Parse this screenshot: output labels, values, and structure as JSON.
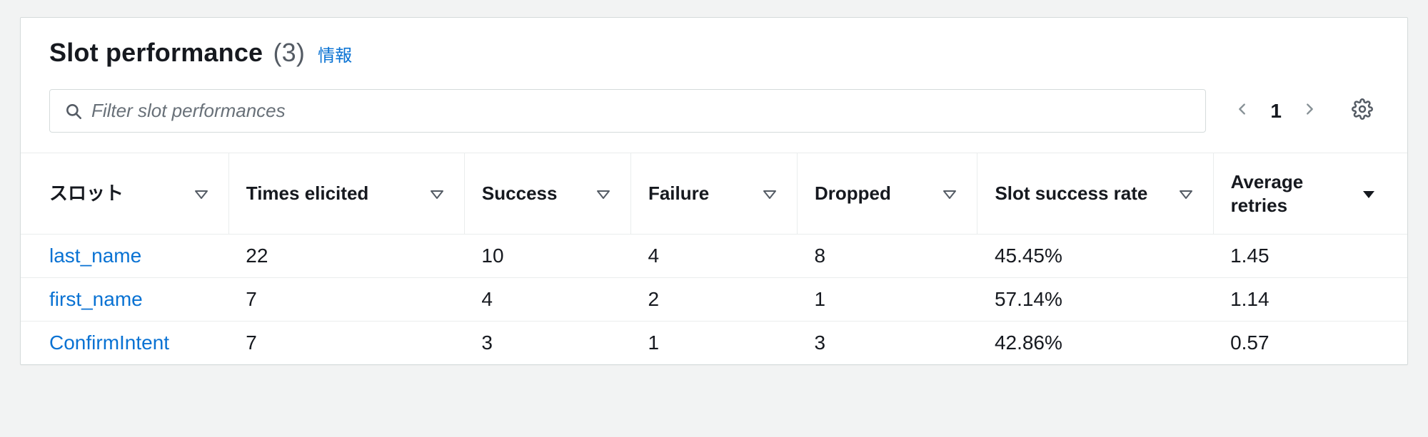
{
  "header": {
    "title": "Slot performance",
    "count_display": "(3)",
    "info_label": "情報"
  },
  "search": {
    "placeholder": "Filter slot performances"
  },
  "pagination": {
    "current": "1"
  },
  "icons": {
    "search": "search-icon",
    "prev": "chevron-left-icon",
    "next": "chevron-right-icon",
    "settings": "gear-icon",
    "sort": "caret-down-outline-icon",
    "sort_active": "caret-down-solid-icon"
  },
  "columns": {
    "slot": "スロット",
    "times_elicited": "Times elicited",
    "success": "Success",
    "failure": "Failure",
    "dropped": "Dropped",
    "slot_success_rate": "Slot success rate",
    "average_retries": "Average retries"
  },
  "rows": [
    {
      "slot": "last_name",
      "times_elicited": "22",
      "success": "10",
      "failure": "4",
      "dropped": "8",
      "slot_success_rate": "45.45%",
      "average_retries": "1.45"
    },
    {
      "slot": "first_name",
      "times_elicited": "7",
      "success": "4",
      "failure": "2",
      "dropped": "1",
      "slot_success_rate": "57.14%",
      "average_retries": "1.14"
    },
    {
      "slot": "ConfirmIntent",
      "times_elicited": "7",
      "success": "3",
      "failure": "1",
      "dropped": "3",
      "slot_success_rate": "42.86%",
      "average_retries": "0.57"
    }
  ],
  "sort": {
    "column": "average_retries",
    "direction": "desc"
  }
}
